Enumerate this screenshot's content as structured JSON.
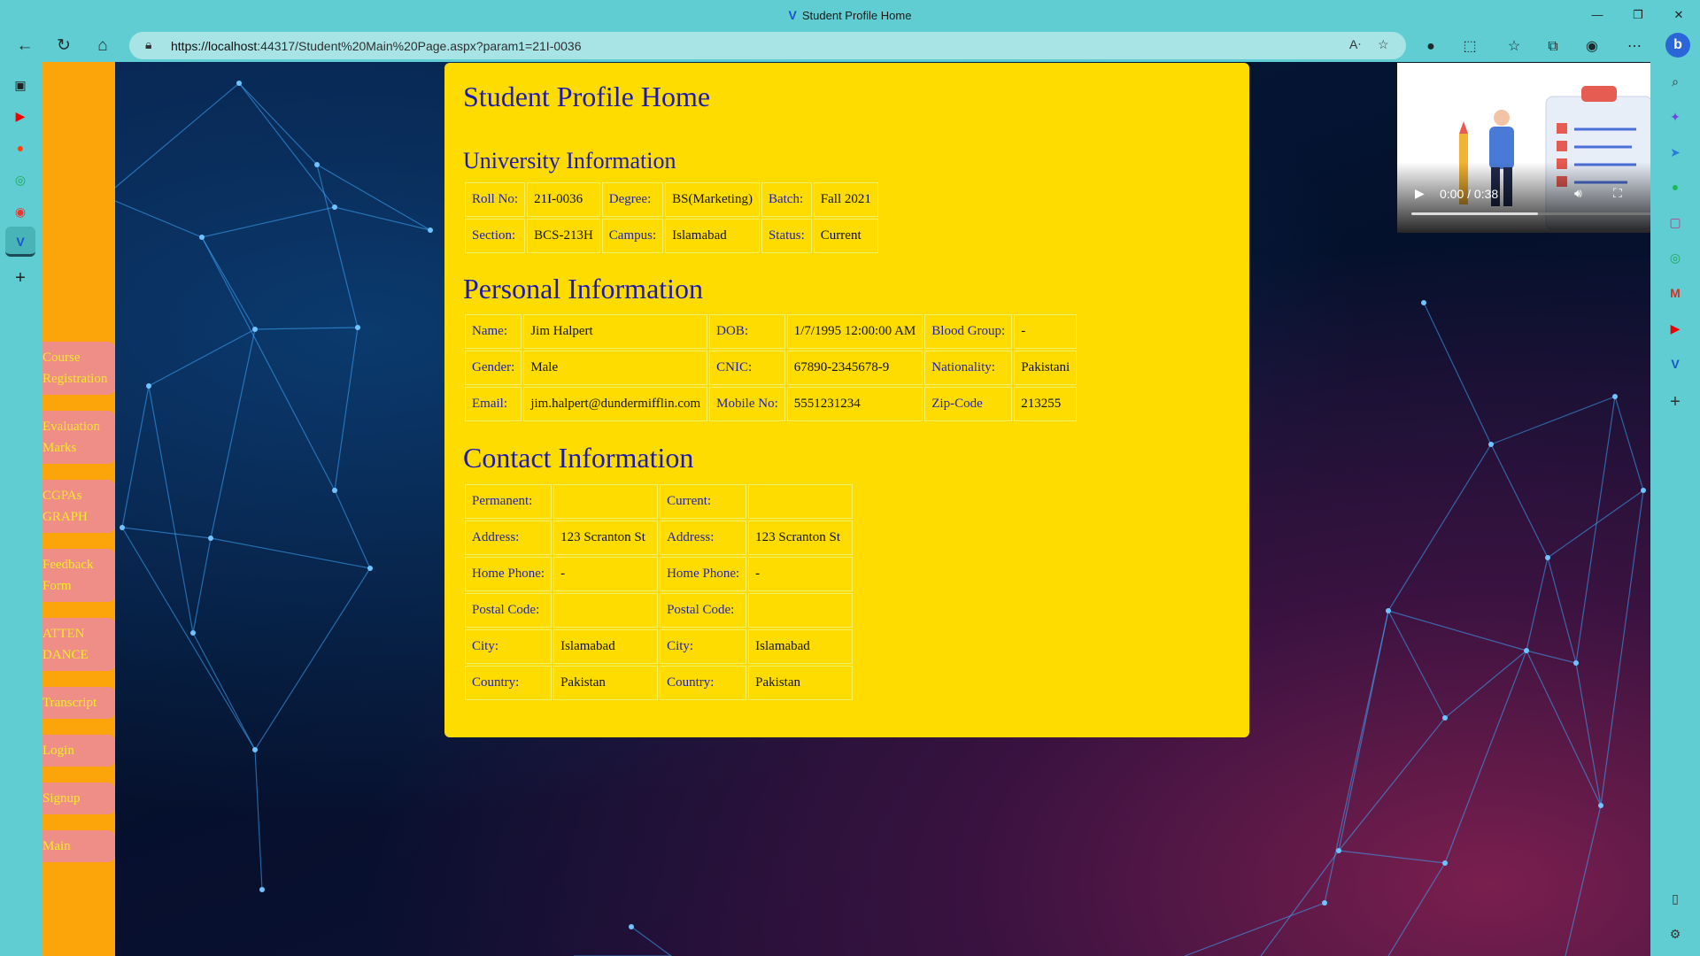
{
  "browser": {
    "window_title": "Student Profile Home",
    "url_host": "https://localhost",
    "url_rest": ":44317/Student%20Main%20Page.aspx?param1=21I-0036",
    "window_controls": {
      "minimize": "—",
      "restore": "❐",
      "close": "✕"
    }
  },
  "nav_links": [
    {
      "label": "Course Registration"
    },
    {
      "label": "Evaluation Marks"
    },
    {
      "label": "CGPAs GRAPH"
    },
    {
      "label": "Feedback Form"
    },
    {
      "label": "ATTEN DANCE"
    },
    {
      "label": "Transcript"
    },
    {
      "label": "Login"
    },
    {
      "label": "Signup"
    },
    {
      "label": "Main"
    }
  ],
  "page": {
    "title": "Student Profile Home",
    "university_heading": "University Information",
    "personal_heading": "Personal Information",
    "contact_heading": "Contact Information"
  },
  "university": {
    "roll_label": "Roll No:",
    "roll": "21I-0036",
    "degree_label": "Degree:",
    "degree": "BS(Marketing)",
    "batch_label": "Batch:",
    "batch": "Fall 2021",
    "section_label": "Section:",
    "section": "BCS-213H",
    "campus_label": "Campus:",
    "campus": "Islamabad",
    "status_label": "Status:",
    "status": "Current"
  },
  "personal": {
    "name_label": "Name:",
    "name": "Jim Halpert",
    "dob_label": "DOB:",
    "dob": "1/7/1995 12:00:00 AM",
    "blood_label": "Blood Group:",
    "blood": "-",
    "gender_label": "Gender:",
    "gender": "Male",
    "cnic_label": "CNIC:",
    "cnic": "67890-2345678-9",
    "nationality_label": "Nationality:",
    "nationality": "Pakistani",
    "email_label": "Email:",
    "email": "jim.halpert@dundermifflin.com",
    "mobile_label": "Mobile No:",
    "mobile": "5551231234",
    "zip_label": "Zip-Code",
    "zip": "213255"
  },
  "contact": {
    "permanent_label": "Permanent:",
    "permanent": "",
    "current_label": "Current:",
    "current": "",
    "address_label": "Address:",
    "perm_address": "123 Scranton St",
    "cur_address": "123 Scranton St",
    "home_phone_label": "Home Phone:",
    "perm_home_phone": "-",
    "cur_home_phone": "-",
    "postal_label": "Postal Code:",
    "perm_postal": "",
    "cur_postal": "",
    "city_label": "City:",
    "perm_city": "Islamabad",
    "cur_city": "Islamabad",
    "country_label": "Country:",
    "perm_country": "Pakistan",
    "cur_country": "Pakistan"
  },
  "video": {
    "time": "0:00 / 0:38",
    "progress": 0.48
  },
  "colors": {
    "card": "#fedc00",
    "nav_bar": "#fca50a",
    "nav_link_bg": "#ee8e86",
    "nav_link_text": "#f7ea2a",
    "heading": "#1e1ab0"
  }
}
